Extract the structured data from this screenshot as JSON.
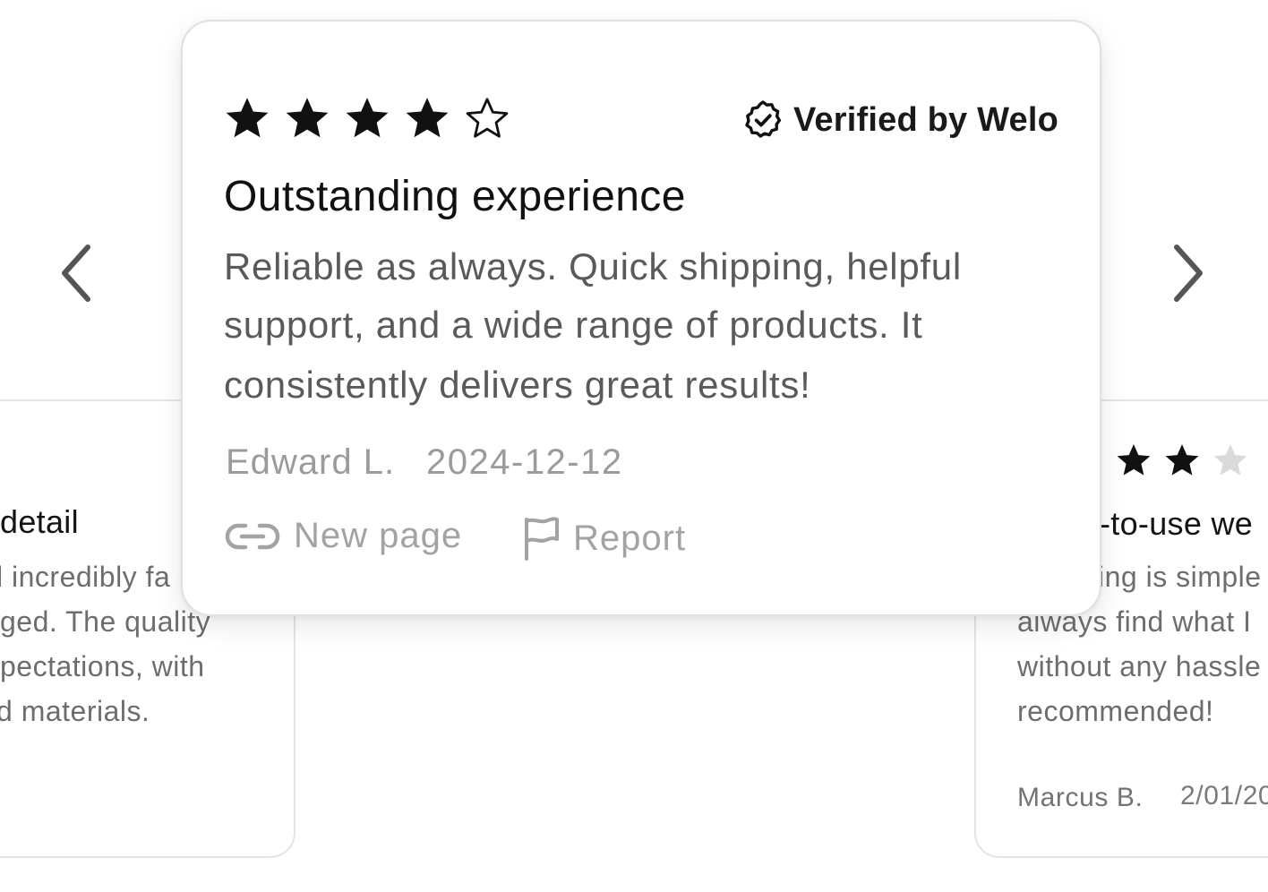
{
  "carousel": {
    "prev_icon": "chevron-left-icon",
    "next_icon": "chevron-right-icon"
  },
  "main_review": {
    "rating": 4,
    "max_rating": 5,
    "verified_label": "Verified by Welo",
    "verified_icon": "badge-check-icon",
    "title": "Outstanding experience",
    "body_lines": [
      "Reliable as always. Quick shipping, helpful",
      "support, and a wide range of products. It",
      "consistently delivers great results!"
    ],
    "author": "Edward L.",
    "date": "2024-12-12",
    "actions": [
      {
        "label": "New page",
        "icon": "link-icon"
      },
      {
        "label": "Report",
        "icon": "flag-icon"
      }
    ]
  },
  "left_review": {
    "title": "detail",
    "body_lines": [
      "l incredibly fa",
      "ged. The quality",
      "pectations, with",
      "d materials."
    ]
  },
  "right_review": {
    "rating": 2,
    "title": "-to-use we",
    "body_lines": [
      "ing is simple",
      "always find what I",
      "without any hassle",
      "recommended!"
    ],
    "author": "Marcus B.",
    "date": "2/01/20"
  },
  "colors": {
    "star_filled": "#111111",
    "star_empty_light": "#d9d9d9",
    "text_muted": "#9b9b9b",
    "card_border": "#e0e0e0"
  }
}
